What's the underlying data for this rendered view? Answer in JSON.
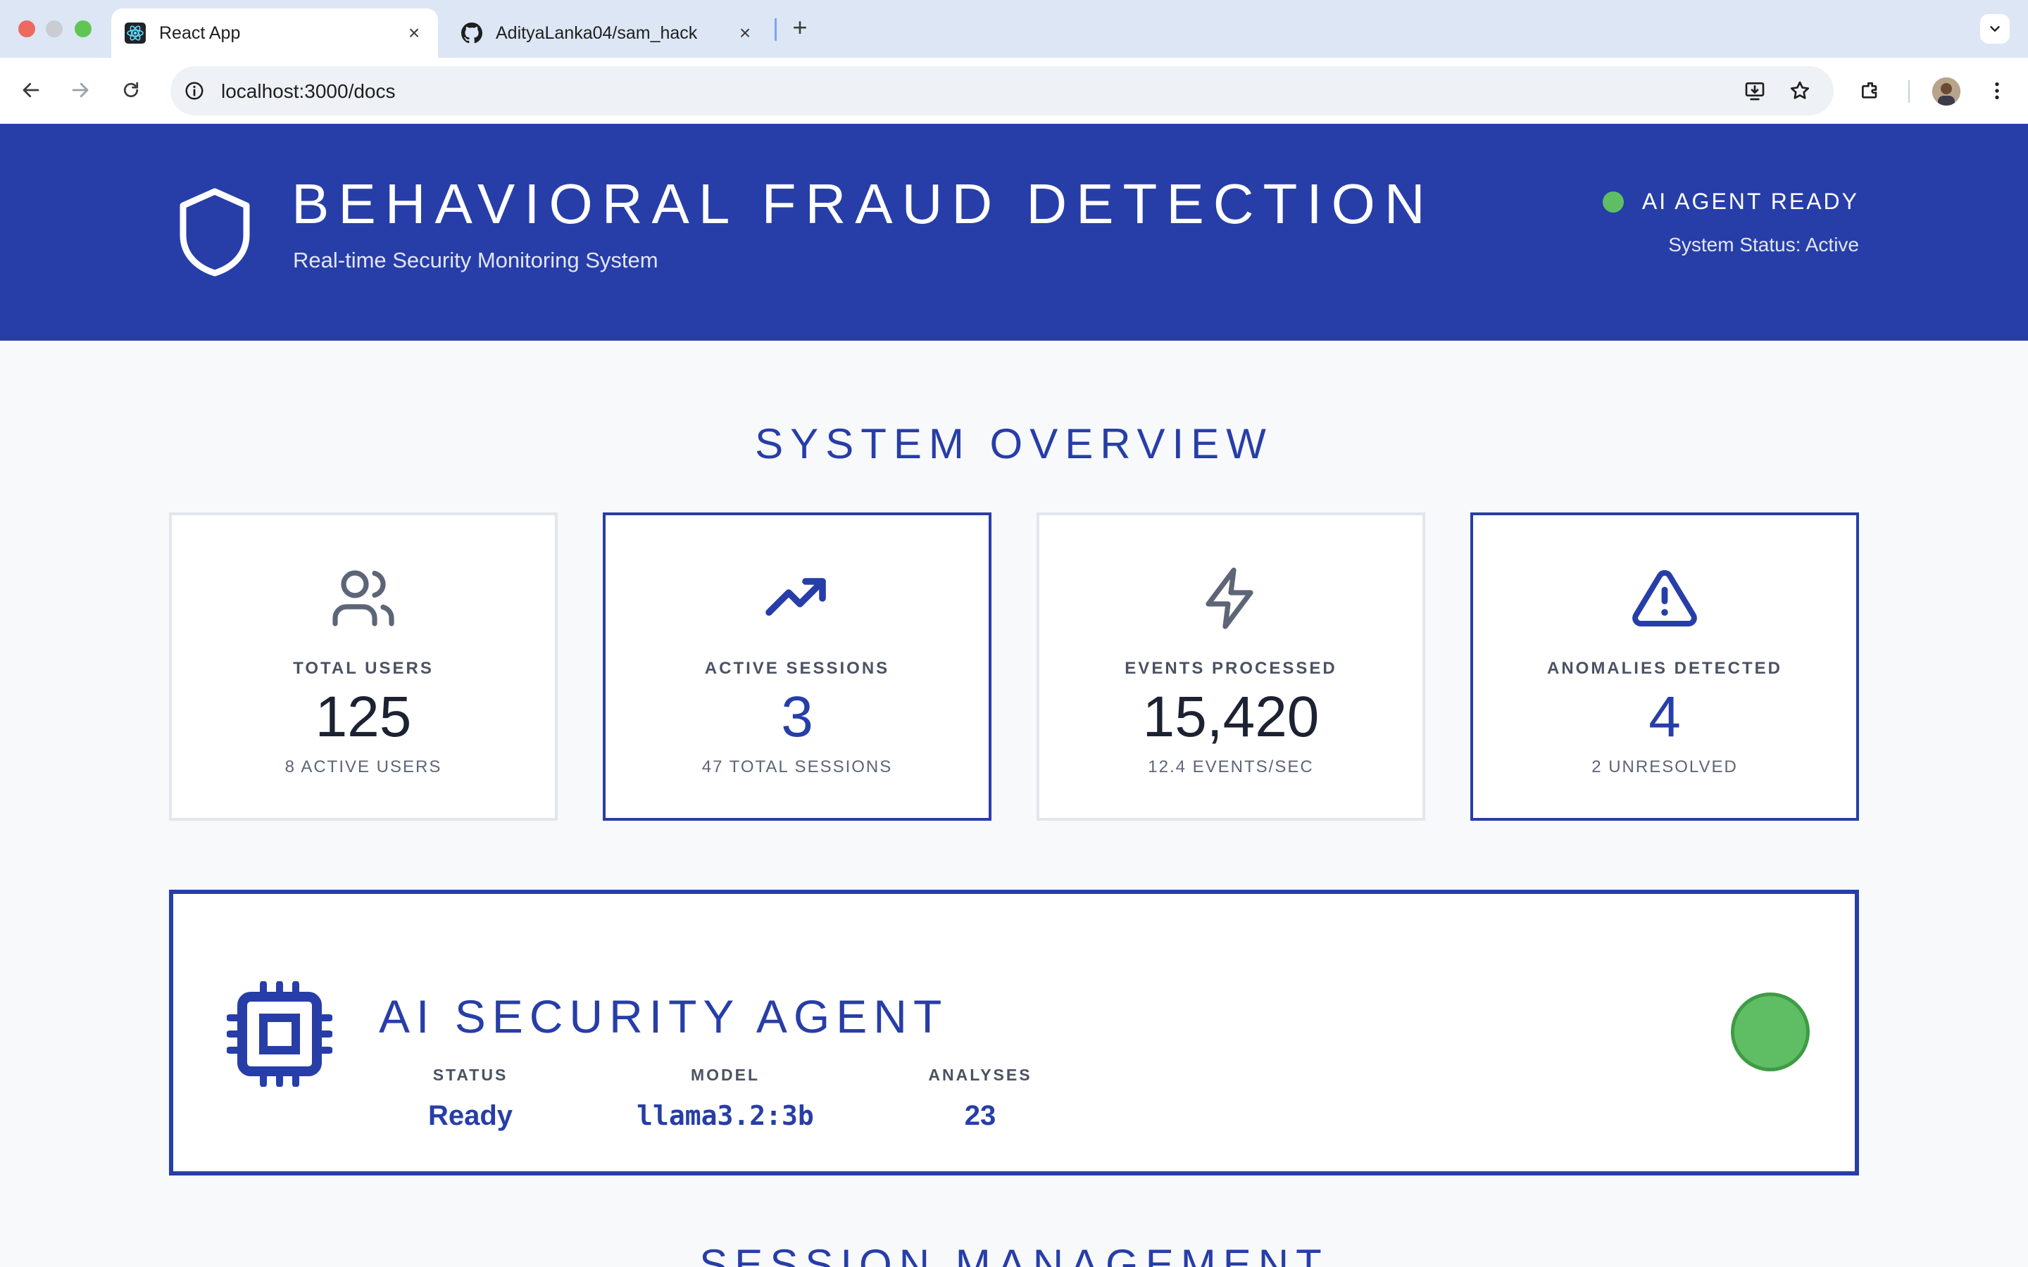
{
  "browser": {
    "tabs": [
      {
        "title": "React App",
        "icon": "react-icon",
        "active": true
      },
      {
        "title": "AdityaLanka04/sam_hack",
        "icon": "github-icon",
        "active": false
      }
    ],
    "new_tab_label": "+",
    "close_glyph": "×",
    "address_bar": {
      "url": "localhost:3000/docs"
    }
  },
  "header": {
    "title": "BEHAVIORAL FRAUD DETECTION",
    "subtitle": "Real-time Security Monitoring System",
    "agent_status": "AI AGENT READY",
    "system_status": "System Status: Active",
    "status_color": "#5fbe63",
    "brand_color": "#273ea8"
  },
  "overview": {
    "title": "SYSTEM OVERVIEW",
    "cards": [
      {
        "icon": "users-icon",
        "label": "TOTAL USERS",
        "value": "125",
        "sub": "8 ACTIVE USERS"
      },
      {
        "icon": "trending-up-icon",
        "label": "ACTIVE SESSIONS",
        "value": "3",
        "sub": "47 TOTAL SESSIONS"
      },
      {
        "icon": "lightning-icon",
        "label": "EVENTS PROCESSED",
        "value": "15,420",
        "sub": "12.4 EVENTS/SEC"
      },
      {
        "icon": "warning-triangle-icon",
        "label": "ANOMALIES DETECTED",
        "value": "4",
        "sub": "2 UNRESOLVED"
      }
    ]
  },
  "agent": {
    "icon": "cpu-chip-icon",
    "title": "AI SECURITY AGENT",
    "stats": [
      {
        "label": "STATUS",
        "value": "Ready"
      },
      {
        "label": "MODEL",
        "value": "llama3.2:3b"
      },
      {
        "label": "ANALYSES",
        "value": "23"
      }
    ]
  },
  "session_section": {
    "title": "SESSION MANAGEMENT"
  }
}
